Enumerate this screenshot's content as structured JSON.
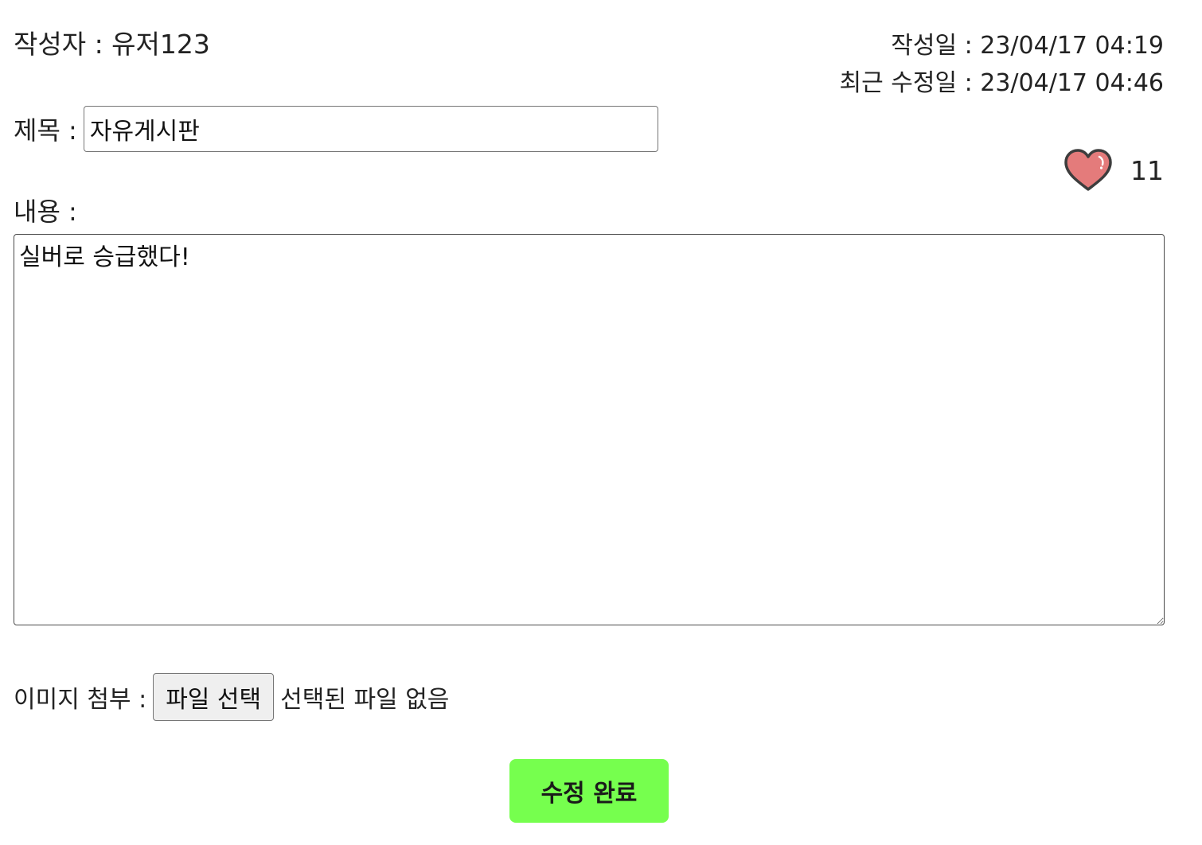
{
  "post": {
    "author_text": "작성자 : 유저123",
    "created_text": "작성일 : 23/04/17 04:19",
    "modified_text": "최근 수정일 : 23/04/17 04:46"
  },
  "form": {
    "title_label": "제목 :",
    "title_value": "자유게시판",
    "content_label": "내용 :",
    "content_value": "실버로 승급했다!",
    "attach_label": "이미지 첨부 :",
    "file_button_label": "파일 선택",
    "file_status": "선택된 파일 없음",
    "submit_label": "수정 완료"
  },
  "like": {
    "icon": "heart-icon",
    "count": "11"
  },
  "colors": {
    "submit_bg": "#76ff4e",
    "heart_fill": "#e47b7b",
    "heart_outline": "#3d3d3d"
  }
}
